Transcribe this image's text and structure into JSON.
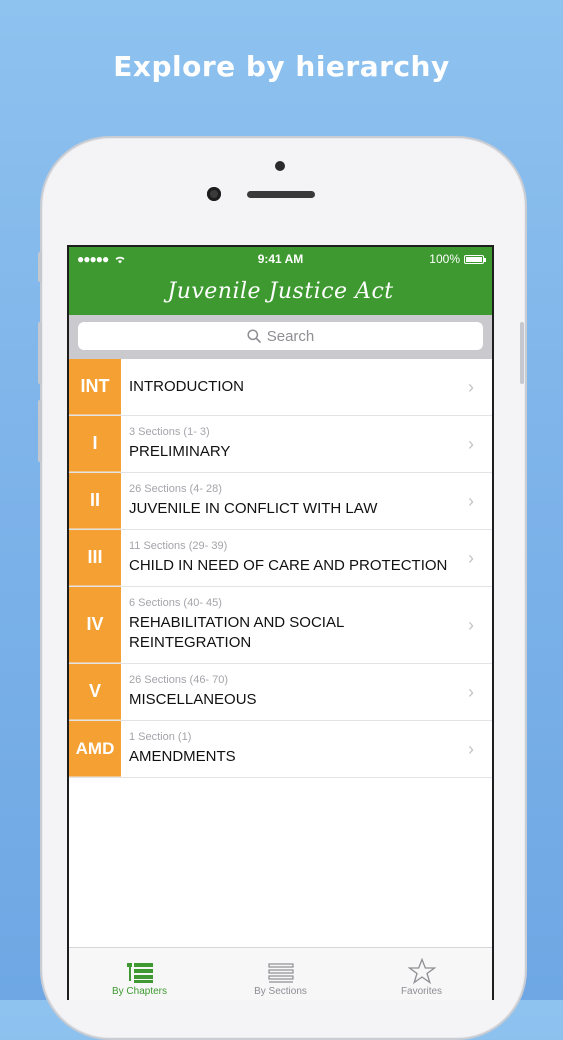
{
  "headline": "Explore by hierarchy",
  "status": {
    "signal": "●●●●●",
    "time": "9:41 AM",
    "battery": "100%"
  },
  "nav": {
    "title": "Juvenile Justice Act"
  },
  "search": {
    "placeholder": "Search"
  },
  "chapters": [
    {
      "badge": "INT",
      "sections": "",
      "title": "INTRODUCTION"
    },
    {
      "badge": "I",
      "sections": "3 Sections (1- 3)",
      "title": "PRELIMINARY"
    },
    {
      "badge": "II",
      "sections": "26 Sections (4- 28)",
      "title": "JUVENILE IN CONFLICT WITH LAW"
    },
    {
      "badge": "III",
      "sections": "11 Sections (29- 39)",
      "title": "CHILD IN NEED OF CARE AND PROTECTION"
    },
    {
      "badge": "IV",
      "sections": "6 Sections (40- 45)",
      "title": "REHABILITATION AND SOCIAL REINTEGRATION"
    },
    {
      "badge": "V",
      "sections": "26 Sections (46- 70)",
      "title": "MISCELLANEOUS"
    },
    {
      "badge": "AMD",
      "sections": "1 Section (1)",
      "title": "AMENDMENTS"
    }
  ],
  "tabs": [
    {
      "label": "By Chapters",
      "icon": "chapters-list-icon",
      "active": true
    },
    {
      "label": "By Sections",
      "icon": "sections-list-icon",
      "active": false
    },
    {
      "label": "Favorites",
      "icon": "star-icon",
      "active": false
    }
  ],
  "colors": {
    "nav_green": "#3e9a30",
    "badge_orange": "#f5a033"
  }
}
